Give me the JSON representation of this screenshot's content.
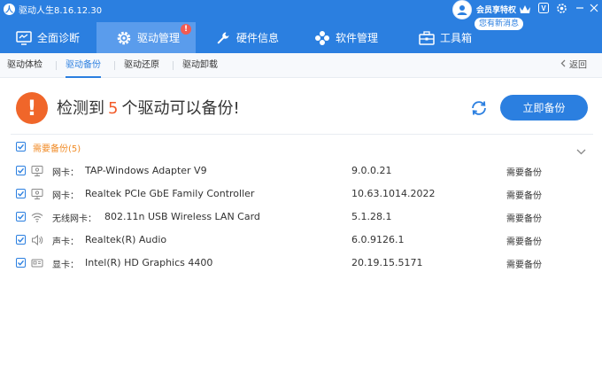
{
  "app": {
    "title": "驱动人生8.16.12.30",
    "logo_glyph": "人"
  },
  "account": {
    "vip_label": "会员享特权",
    "message_pill": "您有新消息",
    "badge_v": "V"
  },
  "window_controls": [
    "crown-icon",
    "vip-v-icon",
    "settings-icon",
    "minimize-icon",
    "close-icon"
  ],
  "tabs": [
    {
      "label": "全面诊断",
      "icon": "monitor-icon"
    },
    {
      "label": "驱动管理",
      "icon": "gear-icon",
      "active": true,
      "badge": "!"
    },
    {
      "label": "硬件信息",
      "icon": "wrench-icon"
    },
    {
      "label": "软件管理",
      "icon": "apps-icon"
    },
    {
      "label": "工具箱",
      "icon": "toolbox-icon"
    }
  ],
  "subnav": {
    "items": [
      "驱动体检",
      "驱动备份",
      "驱动还原",
      "驱动卸载"
    ],
    "active": "驱动备份",
    "back_label": "返回"
  },
  "banner": {
    "prefix": "检测到",
    "count": "5",
    "suffix": "个驱动可以备份!",
    "button_label": "立即备份",
    "warning_glyph": "!"
  },
  "group": {
    "label": "需要备份(5)",
    "checked": true
  },
  "drivers": [
    {
      "type": "网卡：",
      "name": "TAP-Windows Adapter V9",
      "version": "9.0.0.21",
      "status": "需要备份",
      "icon": "network-card-icon"
    },
    {
      "type": "网卡：",
      "name": "Realtek PCIe GbE Family Controller",
      "version": "10.63.1014.2022",
      "status": "需要备份",
      "icon": "network-card-icon"
    },
    {
      "type": "无线网卡：",
      "name": "802.11n USB Wireless LAN Card",
      "version": "5.1.28.1",
      "status": "需要备份",
      "icon": "wifi-icon"
    },
    {
      "type": "声卡：",
      "name": "Realtek(R) Audio",
      "version": "6.0.9126.1",
      "status": "需要备份",
      "icon": "speaker-icon"
    },
    {
      "type": "显卡：",
      "name": "Intel(R) HD Graphics 4400",
      "version": "20.19.15.5171",
      "status": "需要备份",
      "icon": "graphics-card-icon"
    }
  ],
  "colors": {
    "brand": "#2b7fe0",
    "warning": "#f0662a",
    "group_label": "#f08a24"
  }
}
